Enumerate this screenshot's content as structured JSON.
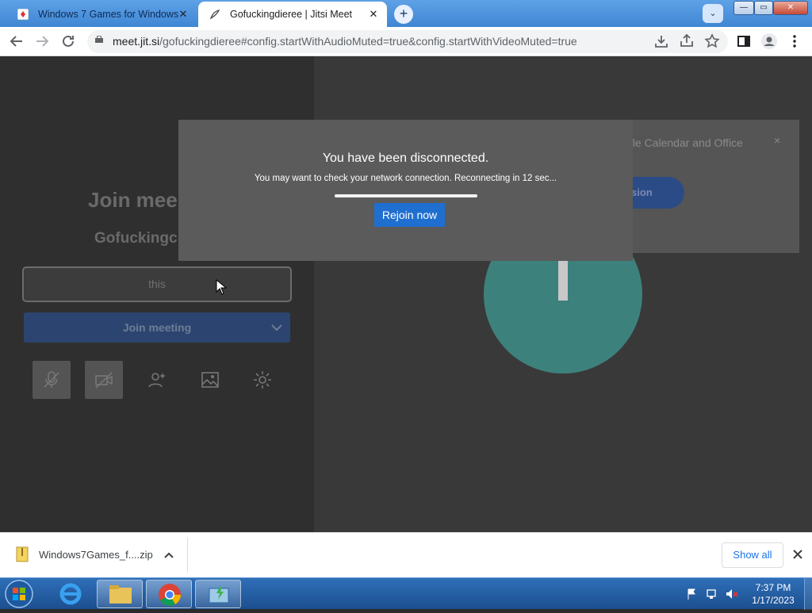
{
  "browser": {
    "tabs": [
      {
        "title": "Windows 7 Games for Windows",
        "active": false
      },
      {
        "title": "Gofuckingdieree | Jitsi Meet",
        "active": true
      }
    ],
    "new_tab_label": "+",
    "tab_search_label": "⌄",
    "window_controls": {
      "minimize": "—",
      "maximize": "▭",
      "close": "✕"
    },
    "url_host": "meet.jit.si",
    "url_rest": "/gofuckingdieree#config.startWithAudioMuted=true&config.startWithVideoMuted=true"
  },
  "prejoin": {
    "title": "Join mee",
    "meeting_name": "Gofuckingc",
    "name_value": "this",
    "join_label": "Join meeting"
  },
  "avatar": {
    "initial": "T",
    "color": "#3f9a94"
  },
  "calendar_banner": {
    "text": "gle Calendar and Office",
    "close": "×",
    "button_fragment": "sion"
  },
  "dialog": {
    "title": "You have been disconnected.",
    "message": "You may want to check your network connection. Reconnecting in 12 sec...",
    "progress": 1.0,
    "rejoin_label": "Rejoin now"
  },
  "downloads": {
    "file_name": "Windows7Games_f....zip",
    "show_all_label": "Show all"
  },
  "taskbar": {
    "time": "7:37 PM",
    "date": "1/17/2023"
  },
  "colors": {
    "accent": "#1f6fd0",
    "titlebar": "#4a90d9"
  }
}
